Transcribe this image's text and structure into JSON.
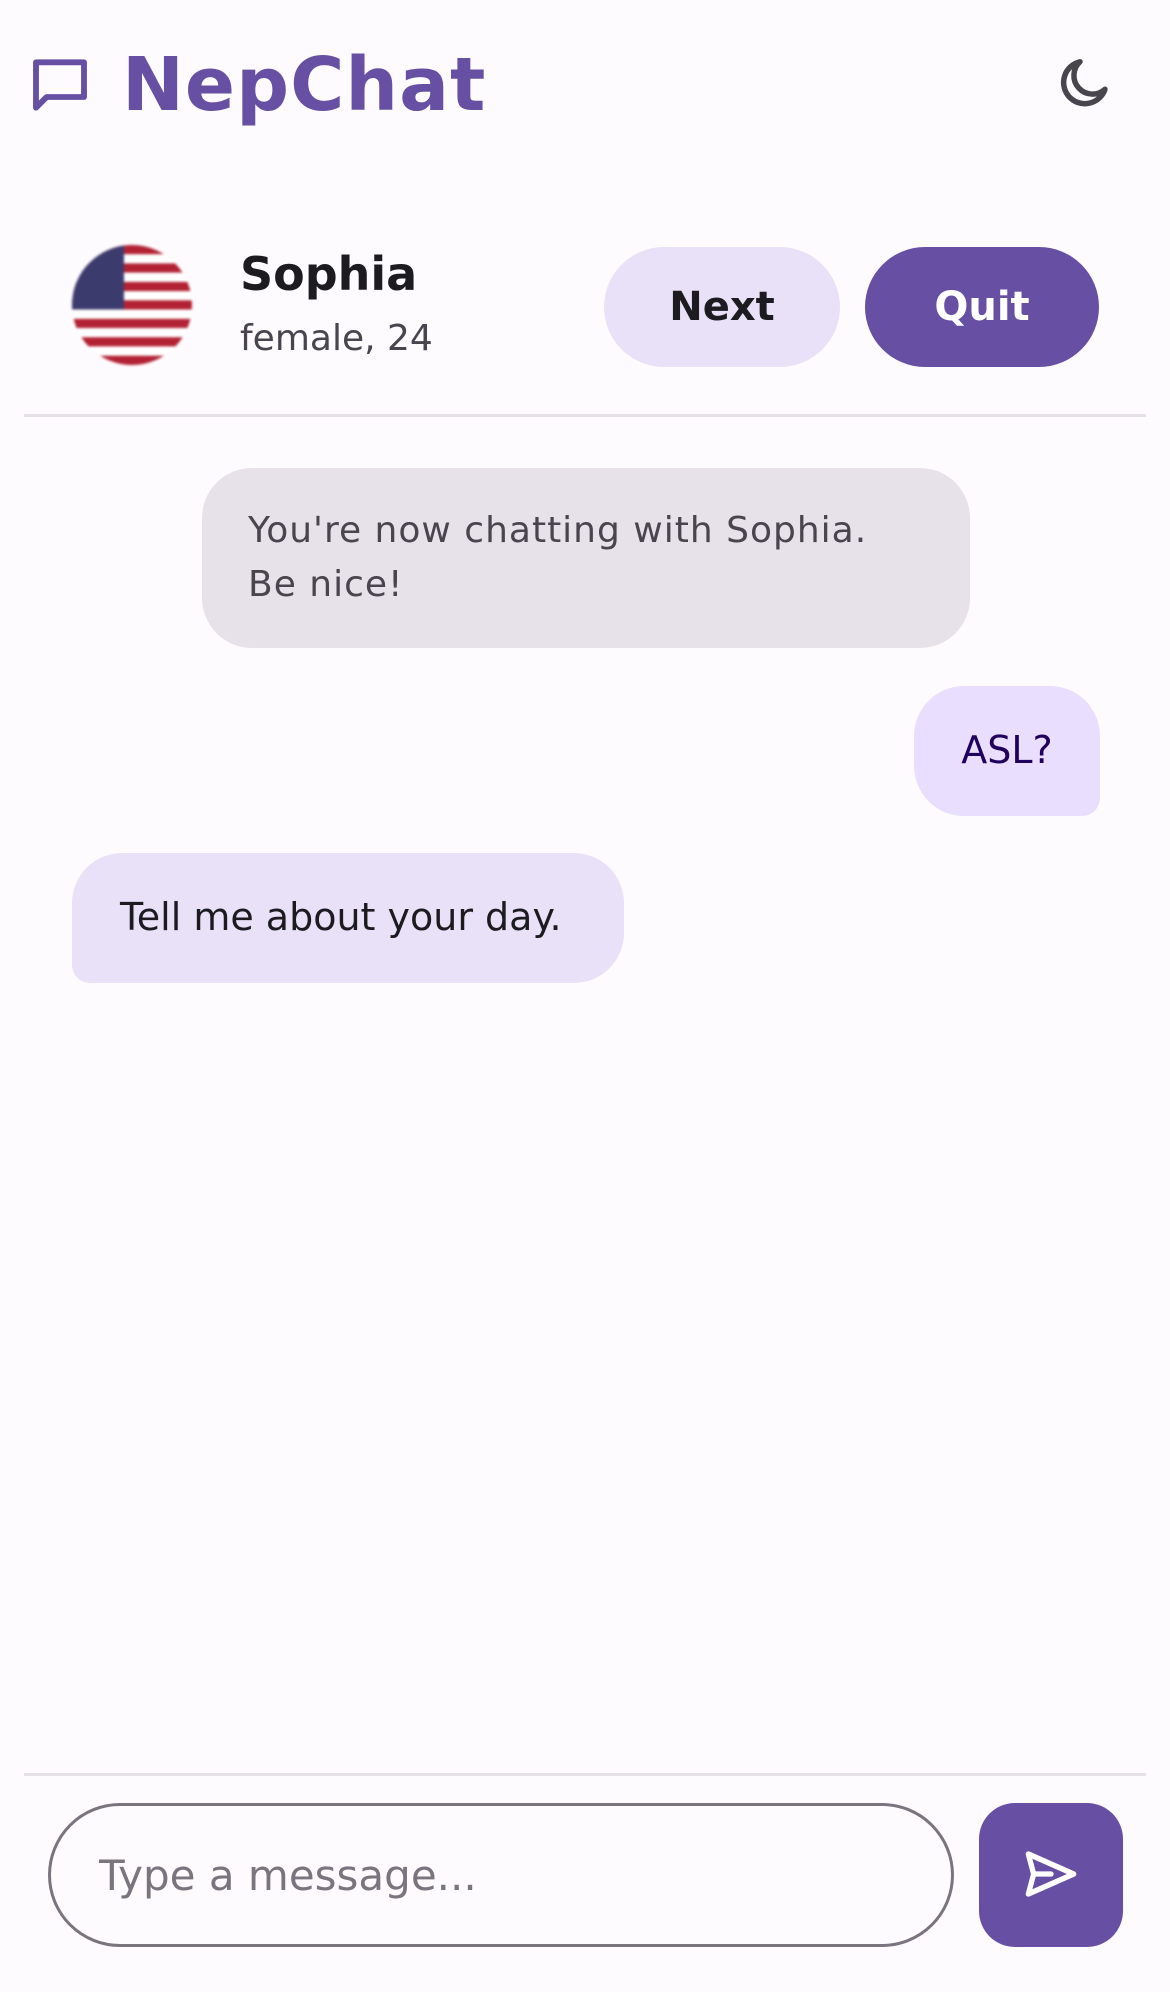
{
  "app": {
    "title": "NepChat",
    "brand_icon": "chat-bubble-icon",
    "theme_icon": "moon-icon",
    "accent_color": "#6750a4"
  },
  "partner": {
    "name": "Sophia",
    "meta": "female, 24",
    "avatar": "us-flag-icon"
  },
  "actions": {
    "next_label": "Next",
    "quit_label": "Quit"
  },
  "messages": {
    "system": "You're now chatting with Sophia. Be nice!",
    "items": [
      {
        "from": "self",
        "text": "ASL?"
      },
      {
        "from": "partner",
        "text": "Tell me about your day."
      }
    ]
  },
  "composer": {
    "placeholder": "Type a message...",
    "value": "",
    "send_icon": "send-icon"
  }
}
